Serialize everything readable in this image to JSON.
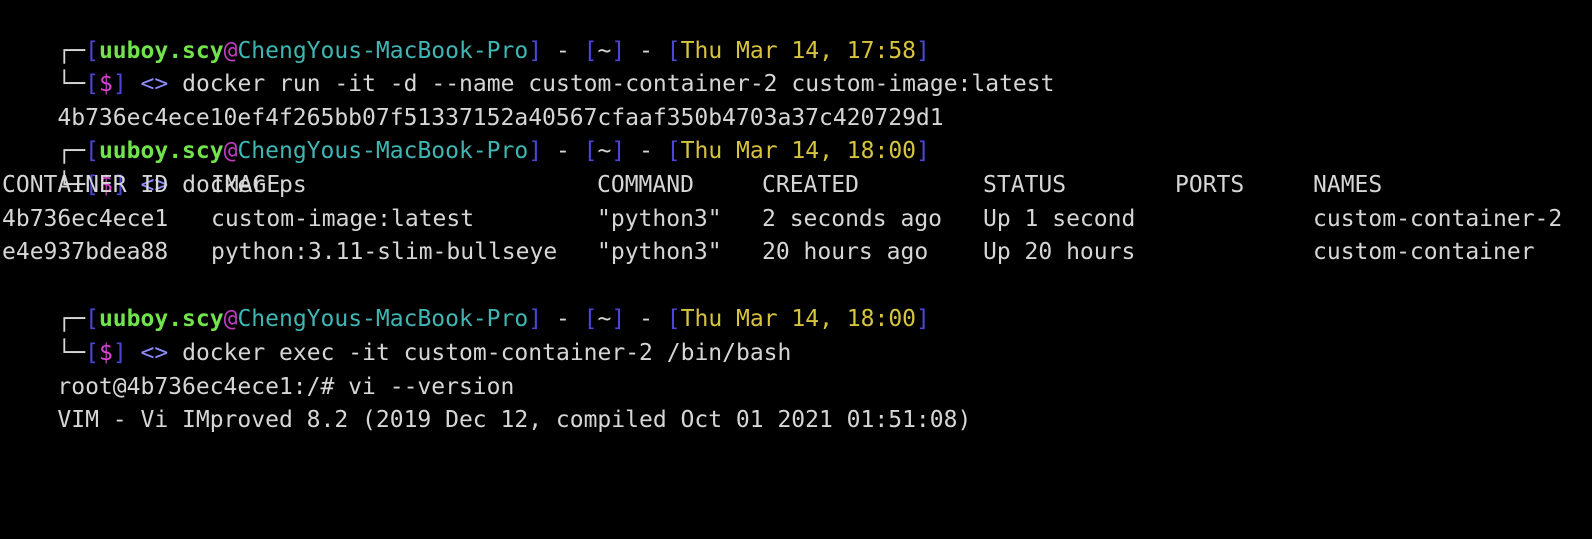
{
  "colors": {
    "background": "#000000",
    "text": "#d6d6d6",
    "bracket": "#4b46d6",
    "user": "#71e34b",
    "host": "#3fb6b3",
    "date": "#d7c43d",
    "dollar": "#d648d6"
  },
  "prompt": {
    "corner_top": "┌─",
    "corner_bottom": "└─",
    "user": "uuboy.scy",
    "at": "@",
    "host": "ChengYous-MacBook-Pro",
    "sep": " - ",
    "path": "~",
    "dollar": "$",
    "arrow": "<>"
  },
  "blocks": [
    {
      "datetime": "Thu Mar 14, 17:58",
      "command": "docker run -it -d --name custom-container-2 custom-image:latest",
      "output": [
        "4b736ec4ece10ef4f265bb07f51337152a40567cfaaf350b4703a37c420729d1"
      ]
    },
    {
      "datetime": "Thu Mar 14, 18:00",
      "command": "docker ps"
    },
    {
      "datetime": "Thu Mar 14, 18:00",
      "command": "docker exec -it custom-container-2 /bin/bash",
      "output": [
        "root@4b736ec4ece1:/# vi --version",
        "VIM - Vi IMproved 8.2 (2019 Dec 12, compiled Oct 01 2021 01:51:08)"
      ]
    }
  ],
  "ps_table": {
    "headers": [
      "CONTAINER ID",
      "IMAGE",
      "COMMAND",
      "CREATED",
      "STATUS",
      "PORTS",
      "NAMES"
    ],
    "rows": [
      [
        "4b736ec4ece1",
        "custom-image:latest",
        "\"python3\"",
        "2 seconds ago",
        "Up 1 second",
        "",
        "custom-container-2"
      ],
      [
        "e4e937bdea88",
        "python:3.11-slim-bullseye",
        "\"python3\"",
        "20 hours ago",
        "Up 20 hours",
        "",
        "custom-container"
      ]
    ]
  }
}
